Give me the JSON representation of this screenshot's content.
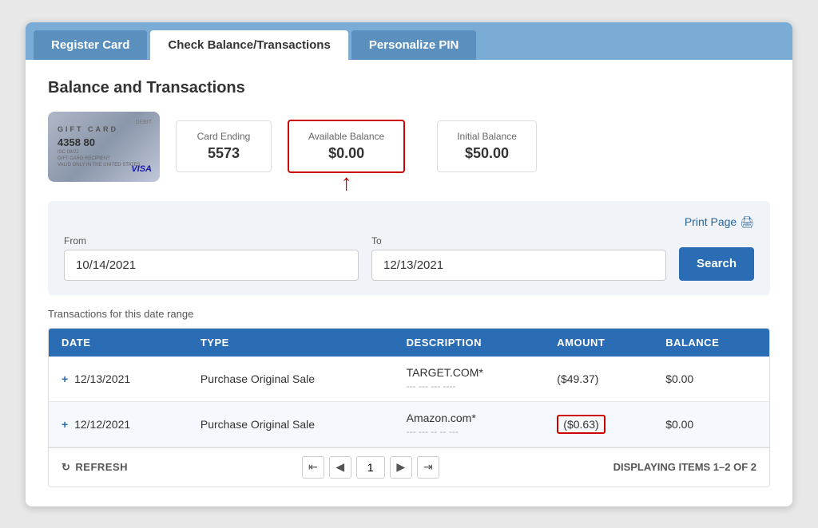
{
  "tabs": [
    {
      "id": "register",
      "label": "Register Card",
      "active": false
    },
    {
      "id": "balance",
      "label": "Check Balance/Transactions",
      "active": true
    },
    {
      "id": "pin",
      "label": "Personalize PIN",
      "active": false
    }
  ],
  "section": {
    "title": "Balance and Transactions"
  },
  "giftCard": {
    "title": "GIFT CARD",
    "number": "4358 80",
    "subLine": "ISC 08/22",
    "subLine2": "GIFT CARD RECIPIENT",
    "subLine3": "VALID ONLY IN THE UNITED STATES",
    "debitLabel": "DEBIT",
    "visaLabel": "VISA"
  },
  "cardInfo": {
    "cardEndingLabel": "Card Ending",
    "cardEndingValue": "5573",
    "availableBalanceLabel": "Available Balance",
    "availableBalanceValue": "$0.00",
    "initialBalanceLabel": "Initial Balance",
    "initialBalanceValue": "$50.00"
  },
  "dateFilter": {
    "fromLabel": "From",
    "fromValue": "10/14/2021",
    "toLabel": "To",
    "toValue": "12/13/2021",
    "searchLabel": "Search",
    "printLabel": "Print Page",
    "rangeLabel": "Transactions for this date range"
  },
  "table": {
    "headers": [
      "DATE",
      "TYPE",
      "DESCRIPTION",
      "AMOUNT",
      "BALANCE"
    ],
    "rows": [
      {
        "date": "12/13/2021",
        "type": "Purchase Original Sale",
        "descLine1": "TARGET.COM*",
        "descLine2": "--- --- --- ----",
        "amount": "($49.37)",
        "balance": "$0.00",
        "amountHighlighted": false
      },
      {
        "date": "12/12/2021",
        "type": "Purchase Original Sale",
        "descLine1": "Amazon.com*",
        "descLine2": "--- --- -- -- ---",
        "amount": "($0.63)",
        "balance": "$0.00",
        "amountHighlighted": true
      }
    ]
  },
  "pagination": {
    "refreshLabel": "REFRESH",
    "currentPage": "1",
    "displayingText": "DISPLAYING ITEMS 1–2 OF 2"
  }
}
